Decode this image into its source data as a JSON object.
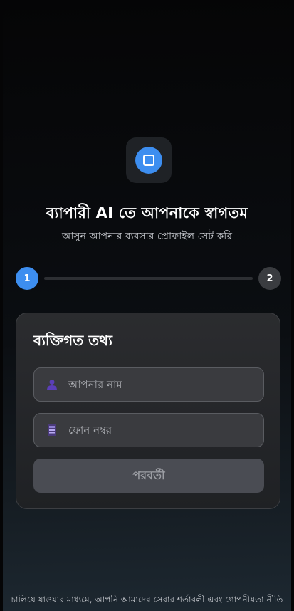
{
  "header": {
    "logo_icon": "square-icon",
    "title": "ব্যাপারী AI তে আপনাকে স্বাগতম",
    "subtitle": "আসুন আপনার ব্যবসার প্রোফাইল সেট করি"
  },
  "stepper": {
    "steps": [
      {
        "label": "1",
        "active": true
      },
      {
        "label": "2",
        "active": false
      }
    ],
    "progress": 0
  },
  "form": {
    "title": "ব্যক্তিগত তথ্য",
    "name_field": {
      "icon": "person-icon",
      "placeholder": "আপনার নাম",
      "value": ""
    },
    "phone_field": {
      "icon": "calculator-icon",
      "placeholder": "ফোন নম্বর",
      "value": ""
    },
    "next_label": "পরবর্তী"
  },
  "footer": {
    "text": "চালিয়ে যাওয়ার মাধ্যমে, আপনি আমাদের সেবার শর্তাবলী এবং গোপনীয়তা নীতি"
  },
  "colors": {
    "accent": "#3d8ef0",
    "icon_purple": "#6b4fc8"
  }
}
